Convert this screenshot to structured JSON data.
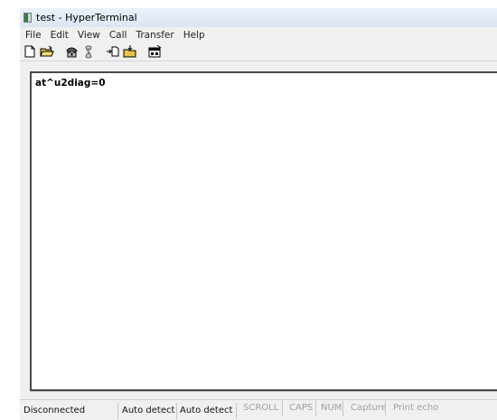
{
  "window": {
    "title": "test - HyperTerminal"
  },
  "menu": [
    "File",
    "Edit",
    "View",
    "Call",
    "Transfer",
    "Help"
  ],
  "toolbar": {
    "icons": [
      "new-connection-icon",
      "open-icon",
      "connect-phone-icon",
      "disconnect-icon",
      "send-file-icon",
      "receive-file-icon",
      "properties-icon"
    ]
  },
  "terminal": {
    "text": "at^u2diag=0"
  },
  "status": {
    "connection": "Disconnected",
    "detect1": "Auto detect",
    "detect2": "Auto detect",
    "scroll": "SCROLL",
    "caps": "CAPS",
    "num": "NUM",
    "capture": "Capture",
    "print_echo": "Print echo"
  }
}
